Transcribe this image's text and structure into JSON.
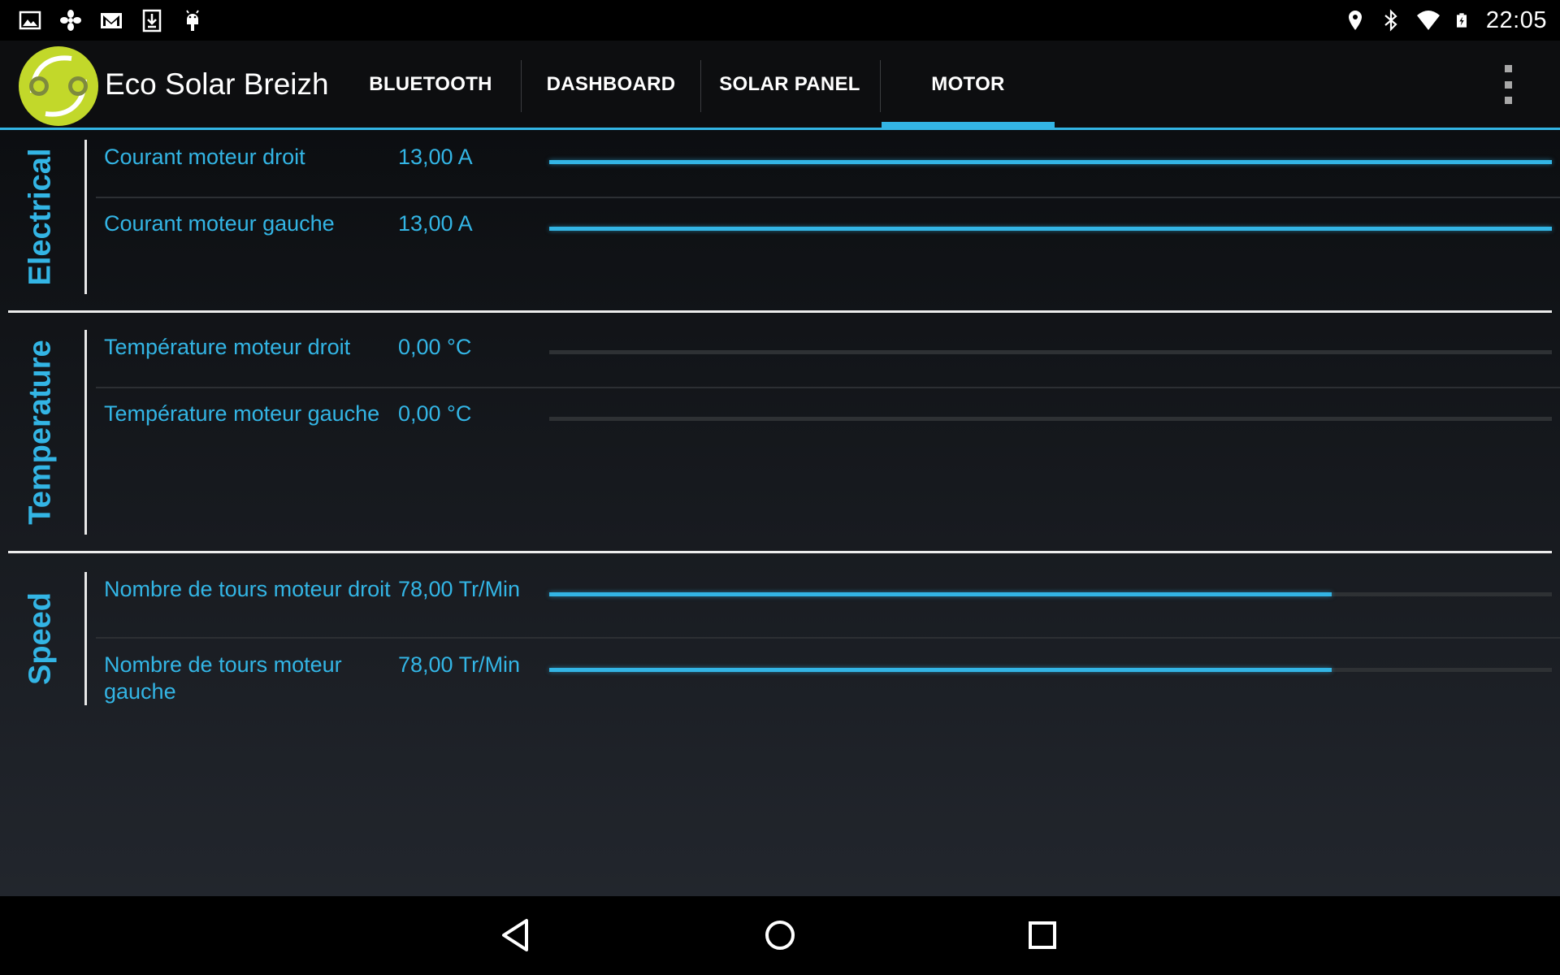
{
  "status_bar": {
    "time": "22:05",
    "notification_icons": [
      "image-icon",
      "fan-icon",
      "gmail-icon",
      "download-icon",
      "android-icon"
    ],
    "system_icons": [
      "location-icon",
      "bluetooth-icon",
      "wifi-icon",
      "battery-charging-icon"
    ]
  },
  "action_bar": {
    "title": "Eco Solar Breizh",
    "logo_icon": "eco-solar-breizh-logo",
    "tabs": [
      {
        "label": "BLUETOOTH",
        "selected": false
      },
      {
        "label": "DASHBOARD",
        "selected": false
      },
      {
        "label": "SOLAR PANEL",
        "selected": false
      },
      {
        "label": "MOTOR",
        "selected": true
      }
    ],
    "overflow_icon": "overflow-menu-icon"
  },
  "sections": [
    {
      "label": "Electrical",
      "rows": [
        {
          "name": "Courant moteur droit",
          "value": "13,00 A",
          "progress": 1.0
        },
        {
          "name": "Courant moteur gauche",
          "value": "13,00 A",
          "progress": 1.0
        }
      ]
    },
    {
      "label": "Temperature",
      "rows": [
        {
          "name": "Température moteur droit",
          "value": "0,00 °C",
          "progress": 0.0
        },
        {
          "name": "Température moteur gauche",
          "value": "0,00 °C",
          "progress": 0.0
        }
      ]
    },
    {
      "label": "Speed",
      "rows": [
        {
          "name": "Nombre de tours moteur droit",
          "value": "78,00 Tr/Min",
          "progress": 0.78
        },
        {
          "name": "Nombre de tours moteur gauche",
          "value": "78,00 Tr/Min",
          "progress": 0.78
        }
      ]
    }
  ],
  "nav_bar": {
    "icons": [
      "back-icon",
      "home-icon",
      "recent-apps-icon"
    ]
  },
  "colors": {
    "accent": "#33b5e5",
    "logo_green": "#c2d82a",
    "background": "#0c0e11"
  }
}
